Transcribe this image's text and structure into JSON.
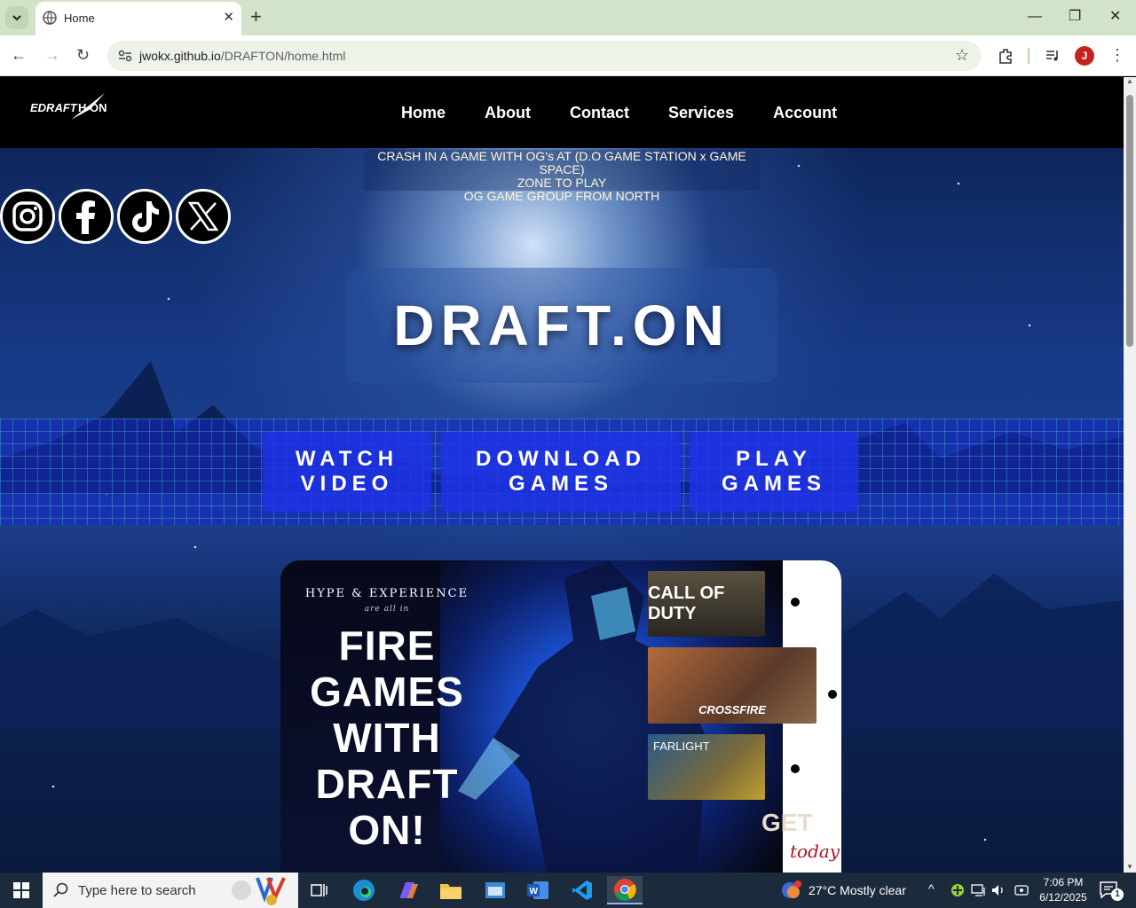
{
  "browser": {
    "tab_title": "Home",
    "url_host": "jwokx.github.io",
    "url_path": "/DRAFTON/home.html",
    "profile_initial": "J"
  },
  "nav": {
    "logo_text": "EDRAFTHON",
    "links": [
      "Home",
      "About",
      "Contact",
      "Services",
      "Account"
    ]
  },
  "ticker": {
    "lines": [
      "CRASH IN A GAME WITH OG's AT (D.O GAME STATION x GAME SPACE)",
      "ZONE TO PLAY",
      "OG GAME GROUP FROM NORTH"
    ]
  },
  "socials": [
    "instagram-icon",
    "facebook-icon",
    "tiktok-icon",
    "x-icon"
  ],
  "hero": {
    "title": "DRAFT.ON"
  },
  "cta": {
    "watch": [
      "WATCH",
      "VIDEO"
    ],
    "download": [
      "DOWNLOAD",
      "GAMES"
    ],
    "play": [
      "PLAY",
      "GAMES"
    ]
  },
  "promo": {
    "kicker": "HYPE & EXPERIENCE",
    "sub": "are all in",
    "headline": [
      "FIRE",
      "GAMES",
      "WITH",
      "DRAFT",
      "ON!"
    ],
    "games": [
      "CALL OF DUTY",
      "CROSSFIRE",
      "FARLIGHT"
    ],
    "get": "GET",
    "today": "today"
  },
  "taskbar": {
    "search_placeholder": "Type here to search",
    "weather": "27°C  Mostly clear",
    "time": "7:06 PM",
    "date": "6/12/2025",
    "notification_count": "1"
  },
  "colors": {
    "tabbar": "#d3e3c9",
    "nav_bg": "#000000",
    "cta_blue": "#1e32e6",
    "taskbar": "#1c2b3c"
  }
}
